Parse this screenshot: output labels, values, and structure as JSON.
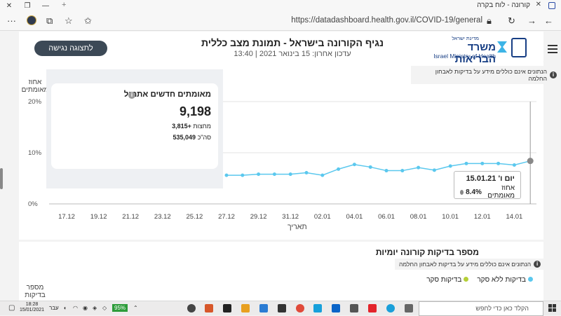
{
  "browser": {
    "tab_title": "קורונה - לוח בקרה",
    "url": "https://datadashboard.health.gov.il/COVID-19/general",
    "window_minimize": "—",
    "window_maximize": "❐",
    "window_close": "✕"
  },
  "header": {
    "title": "נגיף הקורונה בישראל - תמונת מצב כללית",
    "subtitle": "עדכון אחרון: 15 בינואר 2021 | 13:40",
    "overview_button": "לתצוגה נגישה",
    "logo_small": "מדינת ישראל",
    "logo_hebrew": "משרד הבריאות",
    "logo_english": "Israel Ministry of Health"
  },
  "chart_section": {
    "note": "הנתונים אינם כוללים מידע על בדיקות לאבחון החלמה",
    "info_glyph": "i",
    "kpi": {
      "title": "מאומתים חדשים אתמול",
      "value": "9,198",
      "midnight_value": "+3,815",
      "midnight_label": "מחצות",
      "total_value": "535,049",
      "total_label": "סה\"כ"
    },
    "tooltip": {
      "date": "יום ו' 15.01.21",
      "value": "8.4%",
      "label": "אחוז מאומתים"
    }
  },
  "chart_data": {
    "type": "line",
    "ylabel": "אחוז מאומתים",
    "xlabel": "תאריך",
    "ylim": [
      0,
      20
    ],
    "yticks": [
      "20%",
      "10%",
      "0%"
    ],
    "x_tick_labels": [
      "17.12",
      "19.12",
      "21.12",
      "23.12",
      "25.12",
      "27.12",
      "29.12",
      "31.12",
      "02.01",
      "04.01",
      "06.01",
      "08.01",
      "10.01",
      "12.01",
      "14.01"
    ],
    "series": [
      {
        "x": [
          "27.12",
          "28.12",
          "29.12",
          "30.12",
          "31.12",
          "01.01",
          "02.01",
          "03.01",
          "04.01",
          "05.01",
          "06.01",
          "07.01",
          "08.01",
          "09.01",
          "10.01",
          "11.01",
          "12.01",
          "13.01",
          "14.01",
          "15.01"
        ],
        "values": [
          5.6,
          5.6,
          5.8,
          5.8,
          5.8,
          6.1,
          5.6,
          6.8,
          7.7,
          7.2,
          6.5,
          6.5,
          7.1,
          6.6,
          7.4,
          7.9,
          7.9,
          7.9,
          7.6,
          8.4
        ],
        "color": "#5bc8ee"
      }
    ]
  },
  "tests_section": {
    "title": "מספר בדיקות קורונה יומיות",
    "note": "הנתונים אינם כוללים מידע על בדיקות לאבחון החלמה",
    "legend": [
      {
        "label": "בדיקות ללא סקר",
        "color": "#5bc8ee"
      },
      {
        "label": "בדיקות סקר",
        "color": "#b5cf37"
      }
    ],
    "ylabel": "מספר בדיקות"
  },
  "taskbar": {
    "time": "18:28",
    "date": "15/01/2021",
    "lang": "עבר",
    "battery": "95%",
    "search_placeholder": "הקלד כאן כדי לחפש"
  }
}
